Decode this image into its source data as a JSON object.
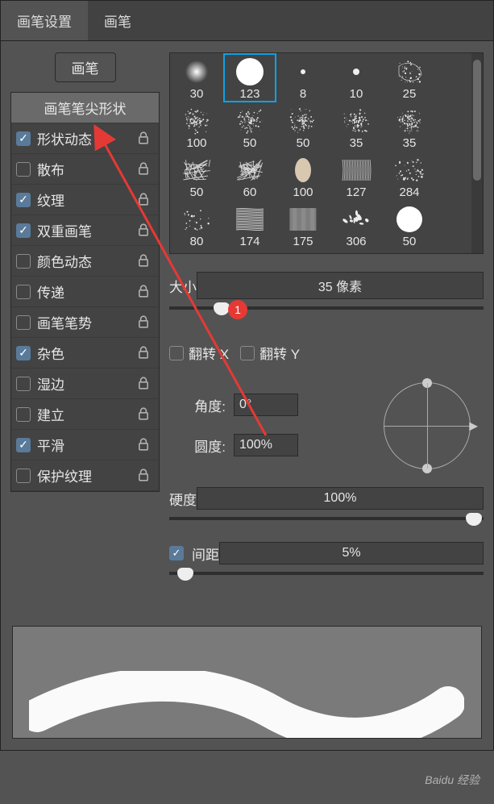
{
  "tabs": {
    "settings": "画笔设置",
    "brushes": "画笔"
  },
  "left": {
    "brush_btn": "画笔",
    "header": "画笔笔尖形状",
    "items": [
      {
        "label": "形状动态",
        "on": true,
        "lock": true
      },
      {
        "label": "散布",
        "on": false,
        "lock": true
      },
      {
        "label": "纹理",
        "on": true,
        "lock": true
      },
      {
        "label": "双重画笔",
        "on": true,
        "lock": true
      },
      {
        "label": "颜色动态",
        "on": false,
        "lock": true
      },
      {
        "label": "传递",
        "on": false,
        "lock": true
      },
      {
        "label": "画笔笔势",
        "on": false,
        "lock": true
      },
      {
        "label": "杂色",
        "on": true,
        "lock": true
      },
      {
        "label": "湿边",
        "on": false,
        "lock": true
      },
      {
        "label": "建立",
        "on": false,
        "lock": true
      },
      {
        "label": "平滑",
        "on": true,
        "lock": true
      },
      {
        "label": "保护纹理",
        "on": false,
        "lock": true
      }
    ]
  },
  "brush_grid": {
    "rows": [
      [
        {
          "s": "30"
        },
        {
          "s": "123",
          "sel": true
        },
        {
          "s": "8"
        },
        {
          "s": "10"
        },
        {
          "s": "25"
        }
      ],
      [
        {
          "s": "100"
        },
        {
          "s": "50"
        },
        {
          "s": "50"
        },
        {
          "s": "35"
        },
        {
          "s": "35"
        }
      ],
      [
        {
          "s": "50"
        },
        {
          "s": "60"
        },
        {
          "s": "100"
        },
        {
          "s": "127"
        },
        {
          "s": "284"
        }
      ],
      [
        {
          "s": "80"
        },
        {
          "s": "174"
        },
        {
          "s": "175"
        },
        {
          "s": "306"
        },
        {
          "s": "50"
        }
      ]
    ]
  },
  "size": {
    "label": "大小",
    "value": "35 像素"
  },
  "flip": {
    "x": "翻转 X",
    "y": "翻转 Y",
    "x_on": false,
    "y_on": false
  },
  "angle": {
    "label": "角度:",
    "value": "0°"
  },
  "roundness": {
    "label": "圆度:",
    "value": "100%"
  },
  "hardness": {
    "label": "硬度",
    "value": "100%"
  },
  "spacing": {
    "label": "间距",
    "value": "5%",
    "on": true
  },
  "annotation": {
    "badge": "1"
  },
  "watermark": "Baidu 经验"
}
